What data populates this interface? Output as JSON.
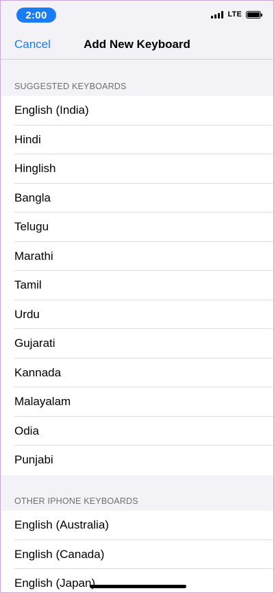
{
  "status_bar": {
    "time": "2:00",
    "network": "LTE"
  },
  "nav": {
    "cancel_label": "Cancel",
    "title": "Add New Keyboard"
  },
  "suggested": {
    "header": "SUGGESTED KEYBOARDS",
    "items": [
      {
        "label": "English (India)"
      },
      {
        "label": "Hindi"
      },
      {
        "label": "Hinglish"
      },
      {
        "label": "Bangla"
      },
      {
        "label": "Telugu"
      },
      {
        "label": "Marathi"
      },
      {
        "label": "Tamil"
      },
      {
        "label": "Urdu"
      },
      {
        "label": "Gujarati"
      },
      {
        "label": "Kannada"
      },
      {
        "label": "Malayalam"
      },
      {
        "label": "Odia"
      },
      {
        "label": "Punjabi"
      }
    ]
  },
  "other": {
    "header": "OTHER IPHONE KEYBOARDS",
    "items": [
      {
        "label": "English (Australia)"
      },
      {
        "label": "English (Canada)"
      },
      {
        "label": "English (Japan)"
      }
    ]
  },
  "colors": {
    "accent": "#1a7cf5",
    "background": "#f2f2f7"
  }
}
